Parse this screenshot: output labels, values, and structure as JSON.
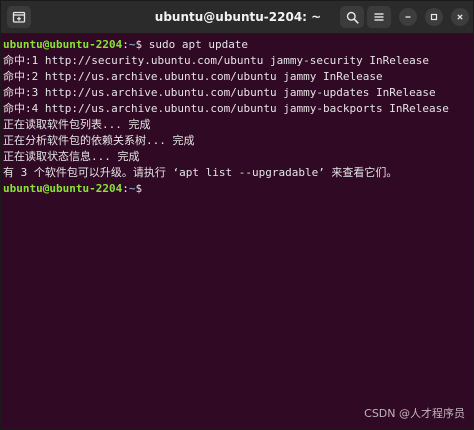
{
  "window": {
    "title": "ubuntu@ubuntu-2204: ~"
  },
  "icons": {
    "new_tab": "new-tab-icon",
    "search": "search-icon",
    "menu": "hamburger-menu-icon",
    "minimize": "minimize-icon",
    "maximize": "maximize-icon",
    "close": "close-icon"
  },
  "colors": {
    "terminal_bg": "#300a24",
    "titlebar_bg": "#2b2b2b",
    "prompt_user": "#8ae234",
    "prompt_path": "#729fcf",
    "text": "#e4e4e4"
  },
  "terminal": {
    "prompt1": {
      "user_host": "ubuntu@ubuntu-2204",
      "sep": ":",
      "path": "~",
      "symbol": "$ ",
      "command": "sudo apt update"
    },
    "output": [
      "命中:1 http://security.ubuntu.com/ubuntu jammy-security InRelease",
      "命中:2 http://us.archive.ubuntu.com/ubuntu jammy InRelease",
      "命中:3 http://us.archive.ubuntu.com/ubuntu jammy-updates InRelease",
      "命中:4 http://us.archive.ubuntu.com/ubuntu jammy-backports InRelease",
      "正在读取软件包列表... 完成",
      "正在分析软件包的依赖关系树... 完成",
      "正在读取状态信息... 完成",
      "有 3 个软件包可以升级。请执行 ‘apt list --upgradable’ 来查看它们。"
    ],
    "prompt2": {
      "user_host": "ubuntu@ubuntu-2204",
      "sep": ":",
      "path": "~",
      "symbol": "$ "
    }
  },
  "watermark": "CSDN @人才程序员"
}
